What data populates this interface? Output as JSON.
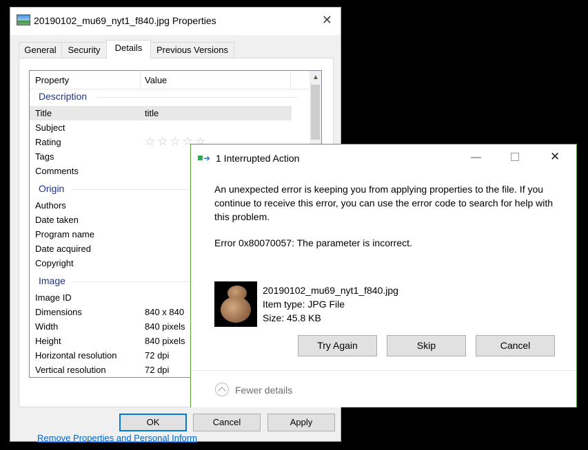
{
  "props": {
    "title": "20190102_mu69_nyt1_f840.jpg Properties",
    "tabs": [
      "General",
      "Security",
      "Details",
      "Previous Versions"
    ],
    "active_tab": "Details",
    "columns": {
      "property": "Property",
      "value": "Value"
    },
    "groups": {
      "description": "Description",
      "origin": "Origin",
      "image": "Image"
    },
    "description_rows": [
      {
        "k": "Title",
        "v": "title"
      },
      {
        "k": "Subject",
        "v": ""
      },
      {
        "k": "Rating",
        "v": ""
      },
      {
        "k": "Tags",
        "v": ""
      },
      {
        "k": "Comments",
        "v": ""
      }
    ],
    "rating_stars": "☆☆☆☆☆",
    "origin_rows": [
      {
        "k": "Authors",
        "v": ""
      },
      {
        "k": "Date taken",
        "v": ""
      },
      {
        "k": "Program name",
        "v": ""
      },
      {
        "k": "Date acquired",
        "v": ""
      },
      {
        "k": "Copyright",
        "v": ""
      }
    ],
    "image_rows": [
      {
        "k": "Image ID",
        "v": ""
      },
      {
        "k": "Dimensions",
        "v": "840 x 840"
      },
      {
        "k": "Width",
        "v": "840 pixels"
      },
      {
        "k": "Height",
        "v": "840 pixels"
      },
      {
        "k": "Horizontal resolution",
        "v": "72 dpi"
      },
      {
        "k": "Vertical resolution",
        "v": "72 dpi"
      }
    ],
    "remove_link": "Remove Properties and Personal Inform",
    "ok": "OK",
    "cancel": "Cancel",
    "apply": "Apply"
  },
  "dialog": {
    "title": "1 Interrupted Action",
    "message": "An unexpected error is keeping you from applying properties to the file. If you continue to receive this error, you can use the error code to search for help with this problem.",
    "error": "Error 0x80070057: The parameter is incorrect.",
    "file_name": "20190102_mu69_nyt1_f840.jpg",
    "item_type": "Item type: JPG File",
    "size": "Size: 45.8 KB",
    "try_again": "Try Again",
    "skip": "Skip",
    "cancel": "Cancel",
    "fewer_details": "Fewer details"
  }
}
